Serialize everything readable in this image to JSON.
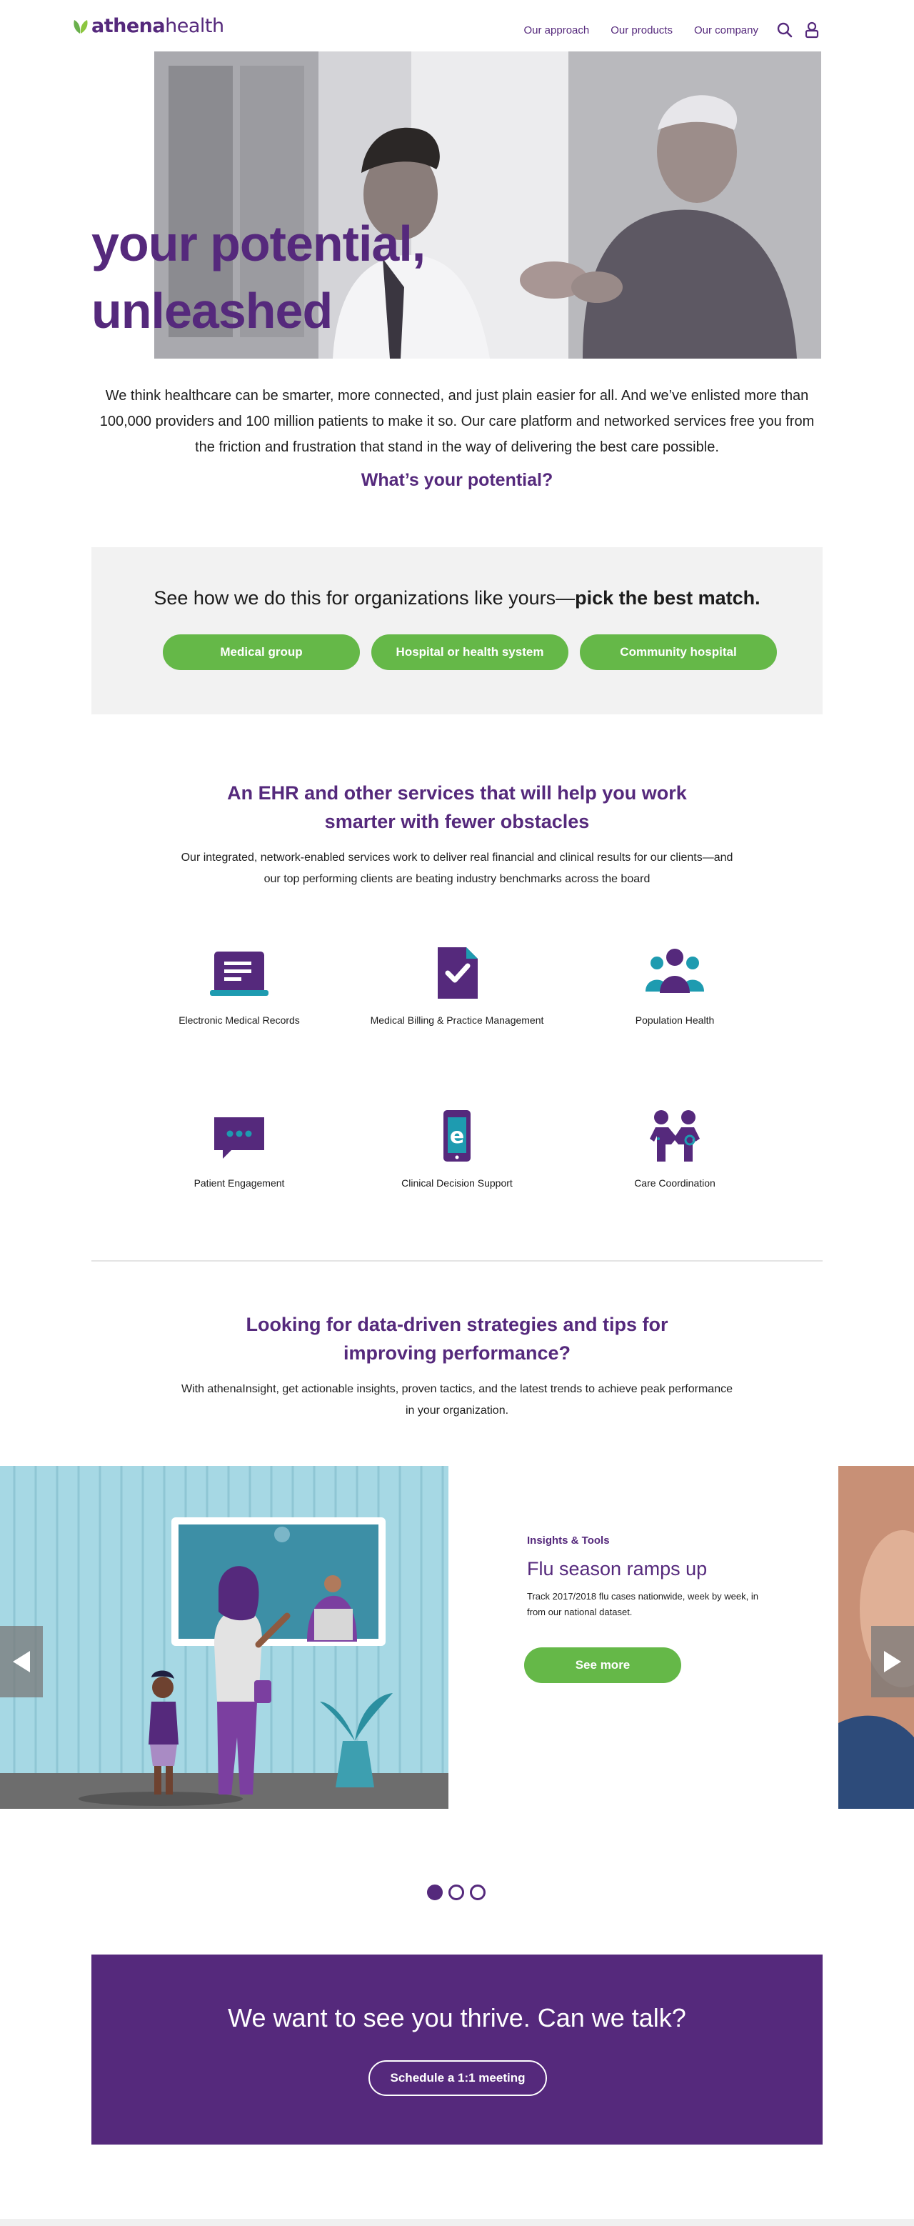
{
  "header": {
    "logo": {
      "bold": "athena",
      "regular": "health"
    },
    "nav": [
      "Our approach",
      "Our products",
      "Our company"
    ],
    "icons": [
      "search-icon",
      "user-icon"
    ]
  },
  "hero": {
    "title_line1": "your potential,",
    "title_line2": "unleashed",
    "intro": "We think healthcare can be smarter, more connected, and just plain easier for all. And we’ve enlisted more than 100,000 providers and 100 million patients to make it so. Our care platform and networked services free you from the friction and frustration that stand in the way of delivering the best care possible.",
    "question": "What’s your potential?"
  },
  "org_match": {
    "title_regular": "See how we do this for organizations like yours—",
    "title_bold": "pick the best match.",
    "buttons": [
      "Medical group",
      "Hospital or health system",
      "Community hospital"
    ]
  },
  "services": {
    "heading_line1": "An EHR and other services that will help you work",
    "heading_line2": "smarter with fewer obstacles",
    "desc_line1": "Our integrated, network-enabled services work to deliver real financial and clinical results for our clients—and",
    "desc_line2": "our top performing clients are beating industry benchmarks across the board",
    "items": [
      {
        "label": "Electronic Medical Records",
        "icon": "document-list-icon"
      },
      {
        "label": "Medical Billing & Practice Management",
        "icon": "checkmark-document-icon"
      },
      {
        "label": "Population Health",
        "icon": "group-icon"
      },
      {
        "label": "Patient Engagement",
        "icon": "chat-bubble-icon"
      },
      {
        "label": "Clinical Decision Support",
        "icon": "mobile-e-icon"
      },
      {
        "label": "Care Coordination",
        "icon": "people-collaboration-icon"
      }
    ]
  },
  "insights": {
    "heading_line1": "Looking for data-driven strategies and tips for",
    "heading_line2": "improving performance?",
    "desc_line1": "With athenaInsight, get actionable insights, proven tactics, and the latest trends to achieve peak performance",
    "desc_line2": "in your organization.",
    "slide": {
      "kicker": "Insights & Tools",
      "title": "Flu season ramps up",
      "body": "Track 2017/2018 flu cases nationwide, week by week, in from our national dataset.",
      "button": "See more"
    },
    "dots_total": 3,
    "dots_active": 1
  },
  "cta": {
    "title": "We want to see you thrive. Can we talk?",
    "button": "Schedule a 1:1 meeting"
  },
  "colors": {
    "brand_purple": "#55297c",
    "accent_green": "#65b848",
    "teal": "#1e9bb0",
    "panel_gray": "#f2f2f2"
  }
}
